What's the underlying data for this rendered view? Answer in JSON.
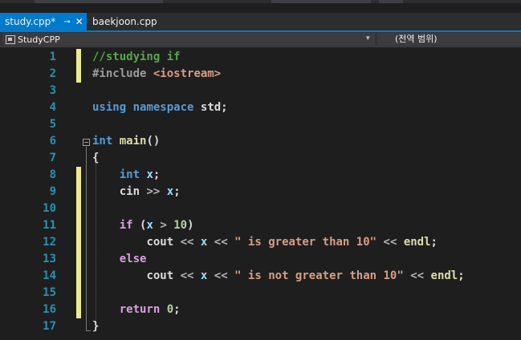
{
  "tabs": [
    {
      "label": "study.cpp*",
      "active": true,
      "pin_icon": "pin-icon",
      "close_icon": "close-icon"
    },
    {
      "label": "baekjoon.cpp",
      "active": false
    }
  ],
  "nav": {
    "project": "StudyCPP",
    "scope": "(전역 범위)"
  },
  "colors": {
    "accent": "#007acc",
    "line_number": "#2b91af",
    "change_marker": "#ecec8c",
    "keyword": "#569cd6",
    "comment": "#57a64a",
    "string": "#d69d85"
  },
  "code": {
    "lines": [
      {
        "n": "1"
      },
      {
        "n": "2"
      },
      {
        "n": "3"
      },
      {
        "n": "4"
      },
      {
        "n": "5"
      },
      {
        "n": "6"
      },
      {
        "n": "7"
      },
      {
        "n": "8"
      },
      {
        "n": "9"
      },
      {
        "n": "10"
      },
      {
        "n": "11"
      },
      {
        "n": "12"
      },
      {
        "n": "13"
      },
      {
        "n": "14"
      },
      {
        "n": "15"
      },
      {
        "n": "16"
      },
      {
        "n": "17"
      }
    ],
    "l1": {
      "comment": "//studying if"
    },
    "l2": {
      "directive": "#include",
      "header": "<iostream>"
    },
    "l4": {
      "using": "using",
      "namespace": "namespace",
      "std": "std;"
    },
    "l6": {
      "type": "int",
      "func": "main",
      "parens": "()"
    },
    "l7": {
      "brace": "{"
    },
    "l8": {
      "type": "int",
      "var": "x",
      "semi": ";"
    },
    "l9": {
      "cin": "cin",
      "op": ">>",
      "var": "x",
      "semi": ";"
    },
    "l11": {
      "kw": "if",
      "open": "(",
      "var": "x",
      "op": ">",
      "num": "10",
      "close": ")"
    },
    "l12": {
      "cout": "cout",
      "op1": "<<",
      "var": "x",
      "op2": "<<",
      "str": "\" is greater than 10\"",
      "op3": "<<",
      "endl": "endl",
      "semi": ";"
    },
    "l13": {
      "kw": "else"
    },
    "l14": {
      "cout": "cout",
      "op1": "<<",
      "var": "x",
      "op2": "<<",
      "str": "\" is not greater than 10\"",
      "op3": "<<",
      "endl": "endl",
      "semi": ";"
    },
    "l16": {
      "kw": "return",
      "num": "0",
      "semi": ";"
    },
    "l17": {
      "brace": "}"
    }
  }
}
